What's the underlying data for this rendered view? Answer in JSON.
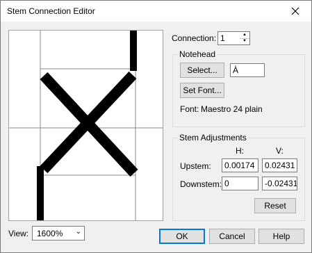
{
  "window": {
    "title": "Stem Connection Editor"
  },
  "connection": {
    "label": "Connection:",
    "value": "1"
  },
  "notehead": {
    "group_title": "Notehead",
    "select_label": "Select...",
    "char_value": "À",
    "set_font_label": "Set Font...",
    "font_label": "Font:",
    "font_value": "Maestro 24 plain"
  },
  "stem": {
    "group_title": "Stem Adjustments",
    "h_header": "H:",
    "v_header": "V:",
    "upstem_label": "Upstem:",
    "upstem_h": "0.00174",
    "upstem_v": "0.02431",
    "downstem_label": "Downstem:",
    "downstem_h": "0",
    "downstem_v": "-0.02431",
    "reset_label": "Reset"
  },
  "view": {
    "label": "View:",
    "value": "1600%"
  },
  "buttons": {
    "ok": "OK",
    "cancel": "Cancel",
    "help": "Help"
  },
  "icons": {
    "close": "close-icon",
    "spin_up": "spin-up-icon",
    "spin_down": "spin-down-icon",
    "dropdown": "chevron-down-icon"
  }
}
